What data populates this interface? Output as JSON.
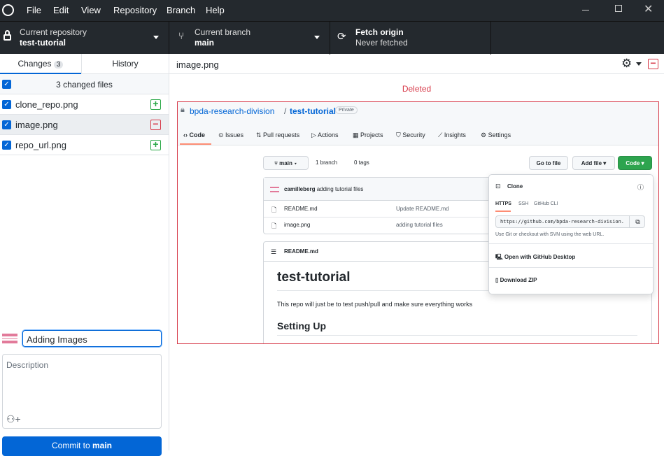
{
  "menu": [
    "File",
    "Edit",
    "View",
    "Repository",
    "Branch",
    "Help"
  ],
  "toolbar": {
    "repo_label": "Current repository",
    "repo_value": "test-tutorial",
    "branch_label": "Current branch",
    "branch_value": "main",
    "fetch_label": "Fetch origin",
    "fetch_sub": "Never fetched"
  },
  "tabs": {
    "changes": "Changes",
    "changes_count": "3",
    "history": "History"
  },
  "changes": {
    "header": "3 changed files",
    "files": [
      {
        "name": "clone_repo.png",
        "status": "added"
      },
      {
        "name": "image.png",
        "status": "deleted"
      },
      {
        "name": "repo_url.png",
        "status": "added"
      }
    ]
  },
  "commit": {
    "summary": "Adding Images",
    "description_placeholder": "Description",
    "button_prefix": "Commit to ",
    "button_branch": "main"
  },
  "diff": {
    "filename": "image.png",
    "status": "Deleted"
  },
  "colors": {
    "accent": "#0366d6",
    "added": "#28a745",
    "deleted": "#d73a49",
    "toolbar": "#24292e"
  },
  "shot": {
    "owner": "bpda-research-division",
    "sep": "/",
    "repo": "test-tutorial",
    "badge": "Private",
    "tabs": [
      "Code",
      "Issues",
      "Pull requests",
      "Actions",
      "Projects",
      "Security",
      "Insights",
      "Settings"
    ],
    "branch": "main",
    "branches": "1 branch",
    "tags": "0 tags",
    "go_to_file": "Go to file",
    "add_file": "Add file",
    "code": "Code",
    "commit_user": "camilleberg",
    "commit_msg": "adding tutorial files",
    "files": [
      {
        "name": "README.md",
        "msg": "Update README.md"
      },
      {
        "name": "image.png",
        "msg": "adding tutorial files"
      }
    ],
    "readme_label": "README.md",
    "h1": "test-tutorial",
    "para": "This repo will just be to test push/pull and make sure everything works",
    "h2": "Setting Up",
    "clone": {
      "title": "Clone",
      "tabs": [
        "HTTPS",
        "SSH",
        "GitHub CLI"
      ],
      "url": "https://github.com/bpda-research-division.",
      "hint": "Use Git or checkout with SVN using the web URL.",
      "open_desktop": "Open with GitHub Desktop",
      "download": "Download ZIP"
    }
  }
}
